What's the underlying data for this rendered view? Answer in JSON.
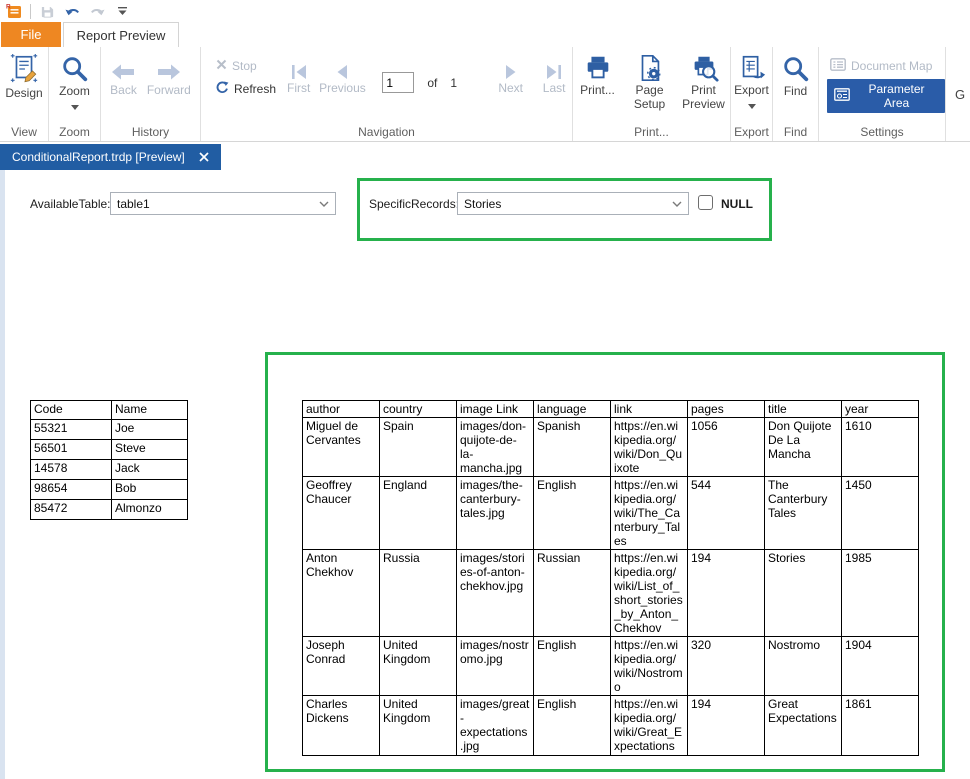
{
  "quick_access": {
    "icons": [
      "app-icon",
      "save-icon",
      "undo-icon",
      "redo-icon",
      "customize-quick-access-icon"
    ]
  },
  "tabs": {
    "file": "File",
    "report_preview": "Report Preview"
  },
  "ribbon": {
    "design": "Design",
    "zoom": "Zoom",
    "back": "Back",
    "forward": "Forward",
    "stop": "Stop",
    "refresh": "Refresh",
    "first": "First",
    "previous": "Previous",
    "page_value": "1",
    "of_label": "of",
    "page_total": "1",
    "next": "Next",
    "last": "Last",
    "print": "Print...",
    "page_setup": "Page Setup",
    "print_preview": "Print Preview",
    "export": "Export",
    "find": "Find",
    "document_map": "Document Map",
    "parameter_area": "Parameter Area",
    "overflow_label": "G",
    "groups": {
      "view": "View",
      "zoom": "Zoom",
      "history": "History",
      "navigation": "Navigation",
      "print": "Print...",
      "export": "Export",
      "find": "Find",
      "settings": "Settings"
    }
  },
  "document_tab": {
    "title": "ConditionalReport.trdp [Preview]"
  },
  "parameters": {
    "available_table_label": "AvailableTable:",
    "available_table_value": "table1",
    "specific_records_label": "SpecificRecords:",
    "specific_records_value": "Stories",
    "null_label": "NULL",
    "null_checked": false
  },
  "colors": {
    "file_tab_orange": "#EE8722",
    "icon_blue": "#3464A8",
    "doc_tab_blue": "#215DA3",
    "selected_blue": "#2A5CA8",
    "highlight_green": "#26B14C",
    "disabled_gray": "#B2BAC6"
  },
  "codes_table": {
    "headers": [
      "Code",
      "Name"
    ],
    "rows": [
      [
        "55321",
        "Joe"
      ],
      [
        "56501",
        "Steve"
      ],
      [
        "14578",
        "Jack"
      ],
      [
        "98654",
        "Bob"
      ],
      [
        "85472",
        "Almonzo"
      ]
    ]
  },
  "books_table": {
    "headers": [
      "author",
      "country",
      "image Link",
      "language",
      "link",
      "pages",
      "title",
      "year"
    ],
    "rows": [
      [
        "Miguel de Cervantes",
        "Spain",
        "images/don-quijote-de-la-mancha.jpg",
        "Spanish",
        "https://en.wikipedia.org/wiki/Don_Quixote",
        "1056",
        "Don Quijote De La Mancha",
        "1610"
      ],
      [
        "Geoffrey Chaucer",
        "England",
        "images/the-canterbury-tales.jpg",
        "English",
        "https://en.wikipedia.org/wiki/The_Canterbury_Tales",
        "544",
        "The Canterbury Tales",
        "1450"
      ],
      [
        "Anton Chekhov",
        "Russia",
        "images/stories-of-anton-chekhov.jpg",
        "Russian",
        "https://en.wikipedia.org/wiki/List_of_short_stories_by_Anton_Chekhov",
        "194",
        "Stories",
        "1985"
      ],
      [
        "Joseph Conrad",
        "United Kingdom",
        "images/nostromo.jpg",
        "English",
        "https://en.wikipedia.org/wiki/Nostromo",
        "320",
        "Nostromo",
        "1904"
      ],
      [
        "Charles Dickens",
        "United Kingdom",
        "images/great-expectations.jpg",
        "English",
        "https://en.wikipedia.org/wiki/Great_Expectations",
        "194",
        "Great Expectations",
        "1861"
      ]
    ]
  }
}
